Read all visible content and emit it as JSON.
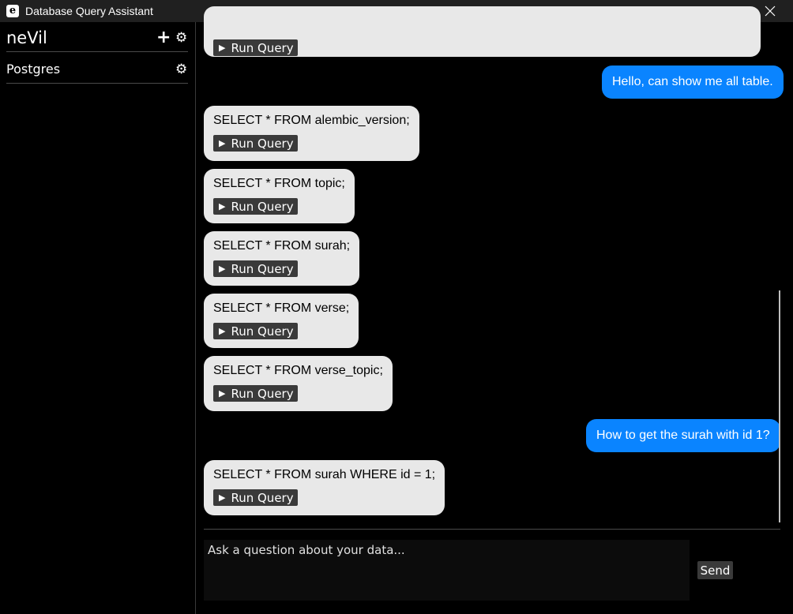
{
  "window": {
    "title": "Database Query Assistant",
    "icon_letter": "e",
    "controls": [
      "minimize-icon",
      "maximize-icon",
      "close-icon"
    ]
  },
  "sidebar": {
    "user": "neVil",
    "add_icon": "plus-icon",
    "settings_icon": "gear-icon",
    "connections": [
      {
        "name": "Postgres",
        "icon": "gear-icon"
      }
    ]
  },
  "chat": {
    "run_label": "Run Query",
    "messages": [
      {
        "role": "bot",
        "text": ""
      },
      {
        "role": "user",
        "text": "Hello, can show me all table."
      },
      {
        "role": "bot",
        "text": "SELECT * FROM alembic_version;"
      },
      {
        "role": "bot",
        "text": "SELECT * FROM topic;"
      },
      {
        "role": "bot",
        "text": "SELECT * FROM surah;"
      },
      {
        "role": "bot",
        "text": "SELECT * FROM verse;"
      },
      {
        "role": "bot",
        "text": "SELECT * FROM verse_topic;"
      },
      {
        "role": "user",
        "text": "How to get the surah with id 1?"
      },
      {
        "role": "bot",
        "text": "SELECT * FROM surah WHERE id = 1;"
      }
    ]
  },
  "composer": {
    "placeholder": "Ask a question about your data...",
    "value": "",
    "send_label": "Send"
  },
  "colors": {
    "user_bubble": "#0a84ff",
    "bot_bubble": "#e8e8e8",
    "button": "#3a3a3a"
  }
}
